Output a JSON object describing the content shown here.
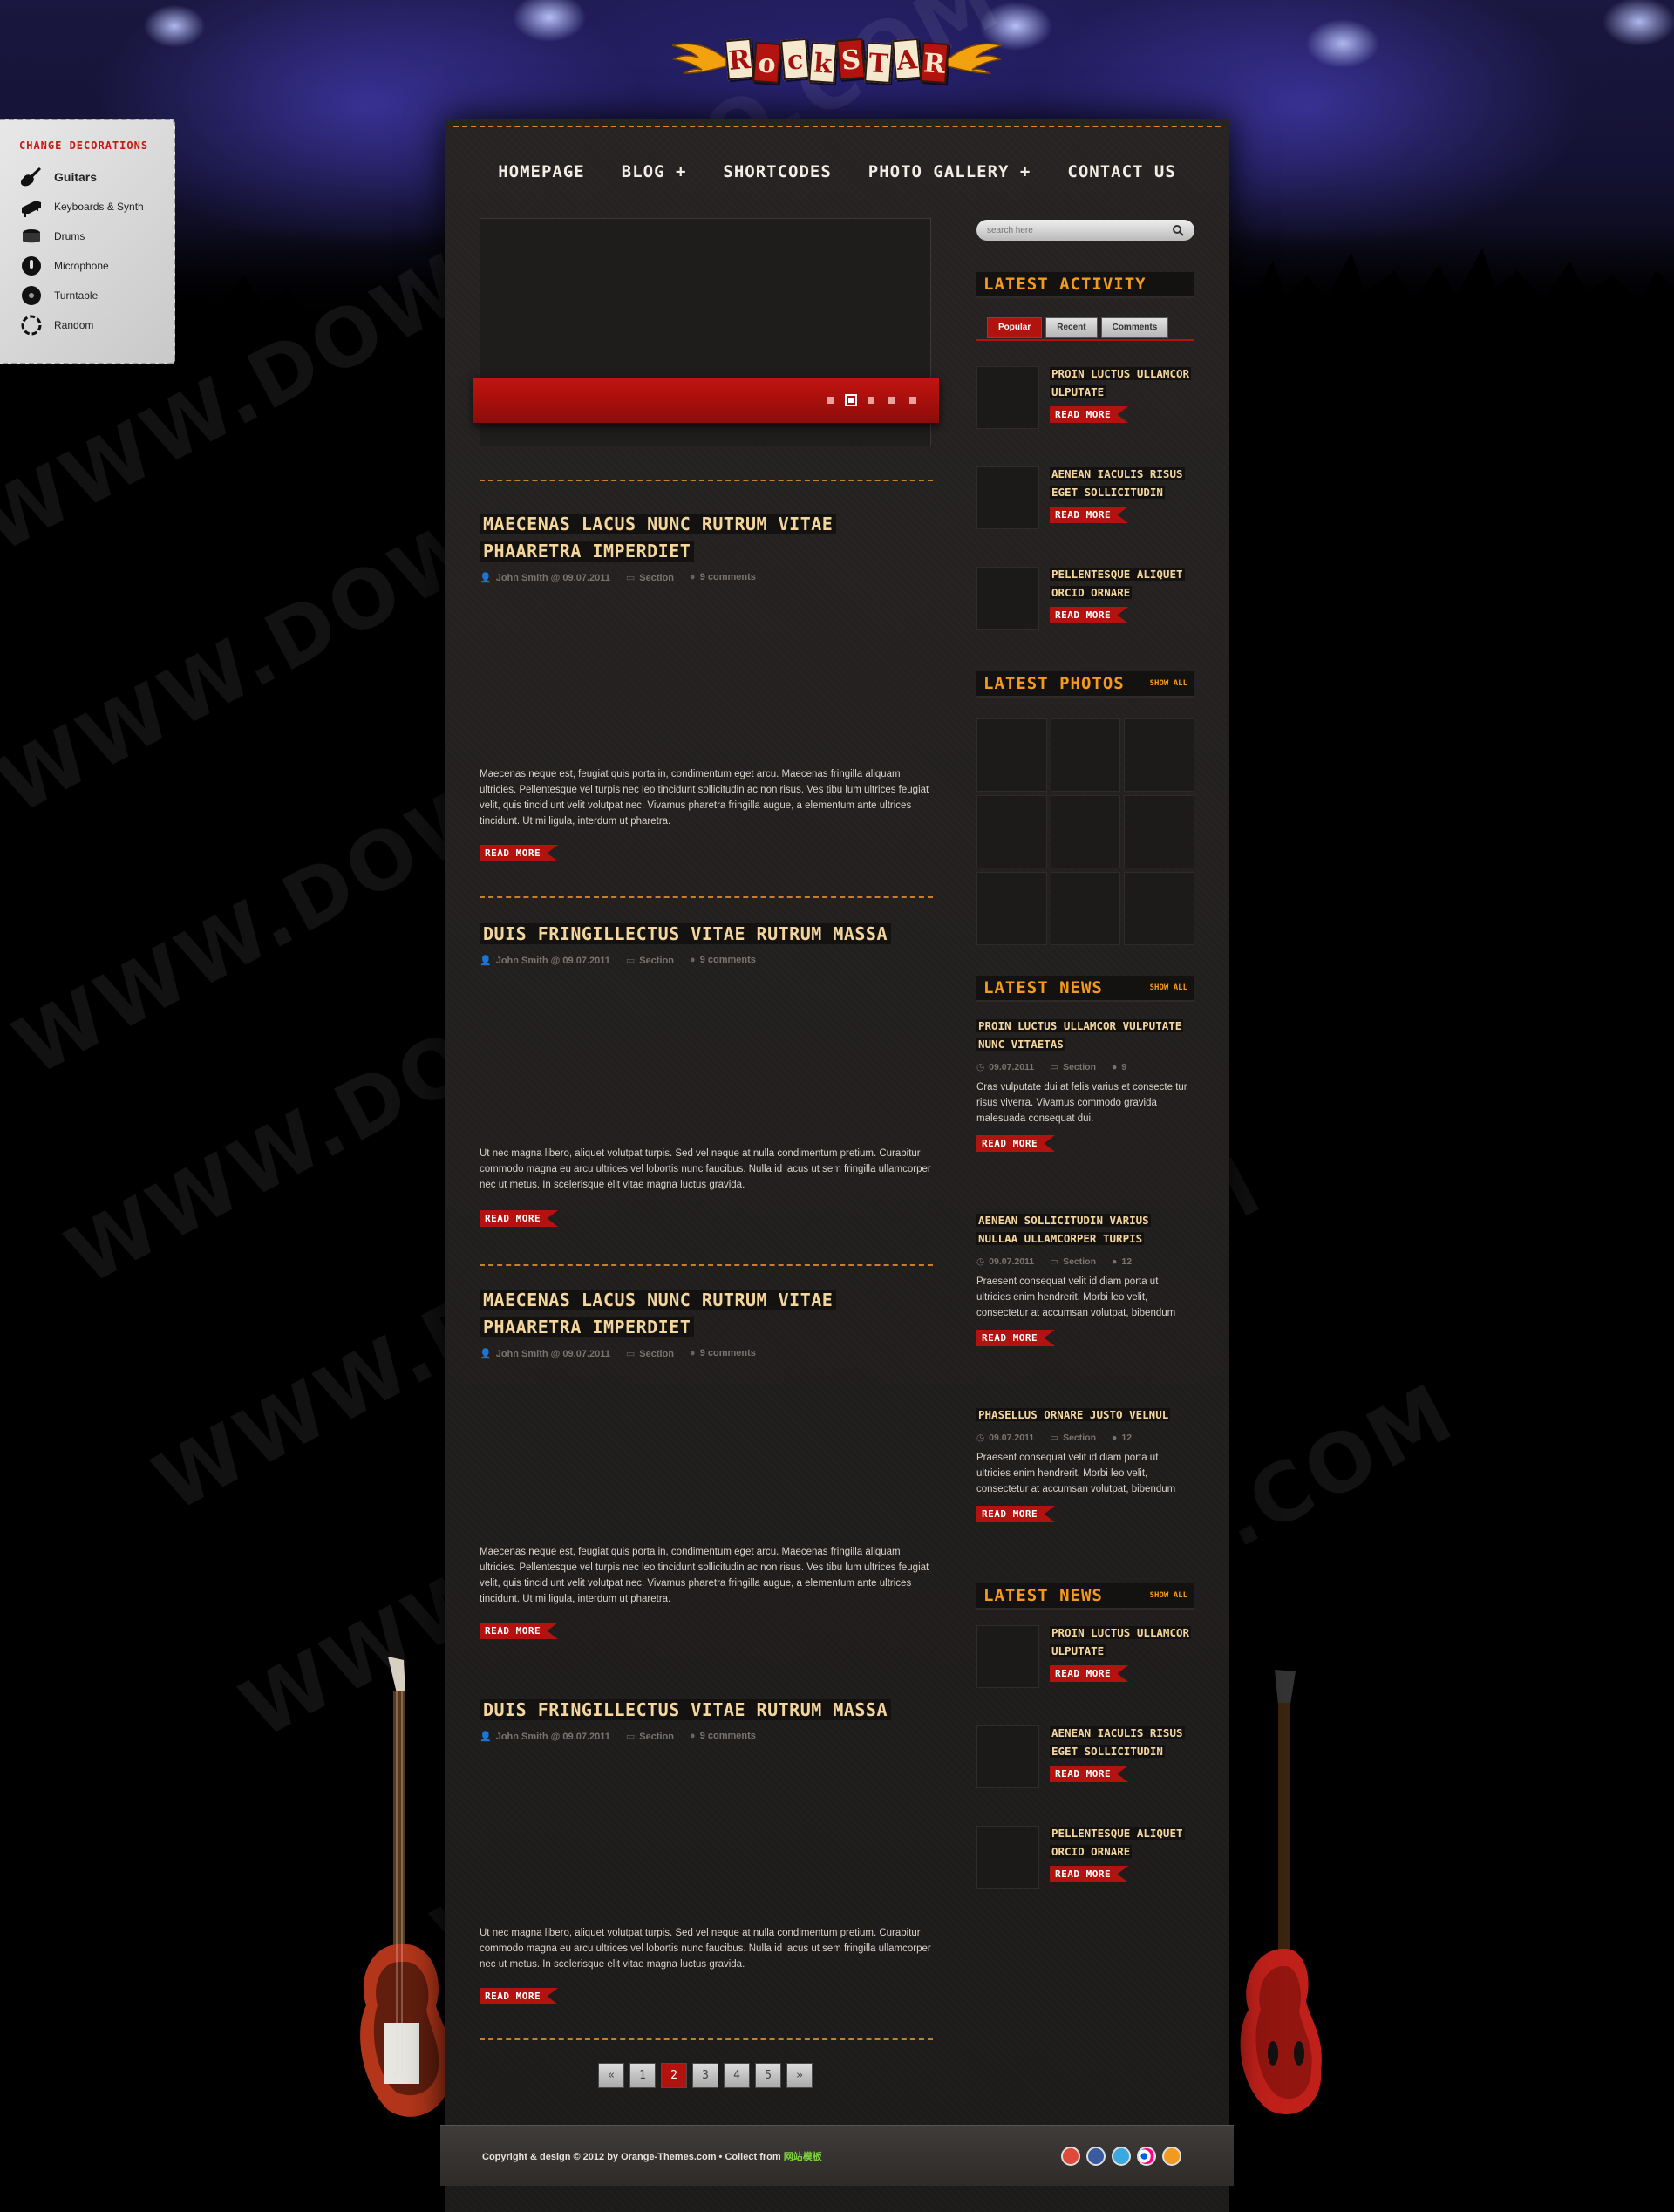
{
  "logo": {
    "letters": [
      "R",
      "o",
      "c",
      "k",
      "S",
      "T",
      "A",
      "R"
    ]
  },
  "decorations": {
    "title": "Change Decorations",
    "items": [
      {
        "label": "Guitars",
        "icon": "guitar-icon",
        "active": true
      },
      {
        "label": "Keyboards & Synth",
        "icon": "piano-icon",
        "active": false
      },
      {
        "label": "Drums",
        "icon": "drum-icon",
        "active": false
      },
      {
        "label": "Microphone",
        "icon": "microphone-icon",
        "active": false
      },
      {
        "label": "Turntable",
        "icon": "turntable-icon",
        "active": false
      },
      {
        "label": "Random",
        "icon": "random-icon",
        "active": false
      }
    ]
  },
  "nav": {
    "items": [
      "Homepage",
      "Blog +",
      "Shortcodes",
      "Photo Gallery +",
      "Contact Us"
    ]
  },
  "slider": {
    "dots": 5,
    "active_dot": 2
  },
  "posts": [
    {
      "title": "Maecenas lacus nunc rutrum vitae phaaretra imperdiet",
      "author": "John Smith @ 09.07.2011",
      "section": "Section",
      "comments": "9 comments",
      "excerpt": "Maecenas neque est, feugiat quis porta in, condimentum eget arcu. Maecenas fringilla aliquam ultricies. Pellentesque vel turpis nec leo tincidunt sollicitudin ac non risus. Ves tibu lum ultrices feugiat velit, quis tincid unt velit volutpat nec. Vivamus pharetra fringilla augue, a elementum ante ultrices tincidunt. Ut mi ligula, interdum ut pharetra.",
      "read_more": "Read More"
    },
    {
      "title": "Duis fringillectus vitae rutrum massa",
      "author": "John Smith @ 09.07.2011",
      "section": "Section",
      "comments": "9 comments",
      "excerpt": "Ut nec magna libero, aliquet volutpat turpis. Sed vel neque at nulla condimentum pretium. Curabitur commodo magna eu arcu ultrices vel lobortis nunc faucibus. Nulla id lacus ut sem fringilla ullamcorper nec ut metus. In scelerisque elit vitae magna luctus gravida.",
      "read_more": "Read More"
    },
    {
      "title": "Maecenas lacus nunc rutrum vitae phaaretra imperdiet",
      "author": "John Smith @ 09.07.2011",
      "section": "Section",
      "comments": "9 comments",
      "excerpt": "Maecenas neque est, feugiat quis porta in, condimentum eget arcu. Maecenas fringilla aliquam ultricies. Pellentesque vel turpis nec leo tincidunt sollicitudin ac non risus. Ves tibu lum ultrices feugiat velit, quis tincid unt velit volutpat nec. Vivamus pharetra fringilla augue, a elementum ante ultrices tincidunt. Ut mi ligula, interdum ut pharetra.",
      "read_more": "Read More"
    },
    {
      "title": "Duis fringillectus vitae rutrum massa",
      "author": "John Smith @ 09.07.2011",
      "section": "Section",
      "comments": "9 comments",
      "excerpt": "Ut nec magna libero, aliquet volutpat turpis. Sed vel neque at nulla condimentum pretium. Curabitur commodo magna eu arcu ultrices vel lobortis nunc faucibus. Nulla id lacus ut sem fringilla ullamcorper nec ut metus. In scelerisque elit vitae magna luctus gravida.",
      "read_more": "Read More"
    }
  ],
  "pagination": {
    "first": "«",
    "pages": [
      "1",
      "2",
      "3",
      "4",
      "5"
    ],
    "current": "2",
    "last": "»"
  },
  "search": {
    "placeholder": "search here"
  },
  "latest_activity": {
    "title": "Latest Activity",
    "tabs": [
      "Popular",
      "Recent",
      "Comments"
    ],
    "active_tab": "Popular",
    "items": [
      {
        "title": "Proin luctus ullamcor ulputate",
        "read_more": "Read More"
      },
      {
        "title": "Aenean iaculis risus eget sollicitudin",
        "read_more": "Read More"
      },
      {
        "title": "Pellentesque aliquet orcid ornare",
        "read_more": "Read More"
      }
    ]
  },
  "latest_photos": {
    "title": "Latest Photos",
    "show_all": "Show All",
    "count": 9
  },
  "latest_news": {
    "title": "Latest News",
    "show_all": "Show All",
    "items": [
      {
        "title": "Proin luctus ullamcor vulputate nunc vitaetas",
        "date": "09.07.2011",
        "section": "Section",
        "comments": "9",
        "excerpt": "Cras vulputate dui at felis varius et consecte tur risus viverra. Vivamus commodo gravida malesuada consequat dui.",
        "read_more": "Read More"
      },
      {
        "title": "Aenean sollicitudin varius nullaa ullamcorper turpis",
        "date": "09.07.2011",
        "section": "Section",
        "comments": "12",
        "excerpt": "Praesent consequat velit id diam porta ut ultricies enim hendrerit. Morbi leo velit, consectetur at accumsan volutpat, bibendum",
        "read_more": "Read More"
      },
      {
        "title": "Phasellus ornare justo velnul",
        "date": "09.07.2011",
        "section": "Section",
        "comments": "12",
        "excerpt": "Praesent consequat velit id diam porta ut ultricies enim hendrerit. Morbi leo velit, consectetur at accumsan volutpat, bibendum",
        "read_more": "Read More"
      }
    ]
  },
  "latest_news_2": {
    "title": "Latest News",
    "show_all": "Show All",
    "items": [
      {
        "title": "Proin luctus ullamcor ulputate",
        "read_more": "Read More"
      },
      {
        "title": "Aenean iaculis risus eget sollicitudin",
        "read_more": "Read More"
      },
      {
        "title": "Pellentesque aliquet orcid ornare",
        "read_more": "Read More"
      }
    ]
  },
  "footer": {
    "copyright": "Copyright & design © 2012 by Orange-Themes.com • Collect from ",
    "collect_link": "网站模板",
    "social": [
      "youtube-icon",
      "facebook-icon",
      "twitter-icon",
      "flickr-icon",
      "rss-icon"
    ]
  },
  "watermark": "WWW.DOWNDEMO.COM",
  "colors": {
    "accent_red": "#b3130f",
    "title_cream": "#f4d69c",
    "widget_orange": "#f39a1f"
  }
}
